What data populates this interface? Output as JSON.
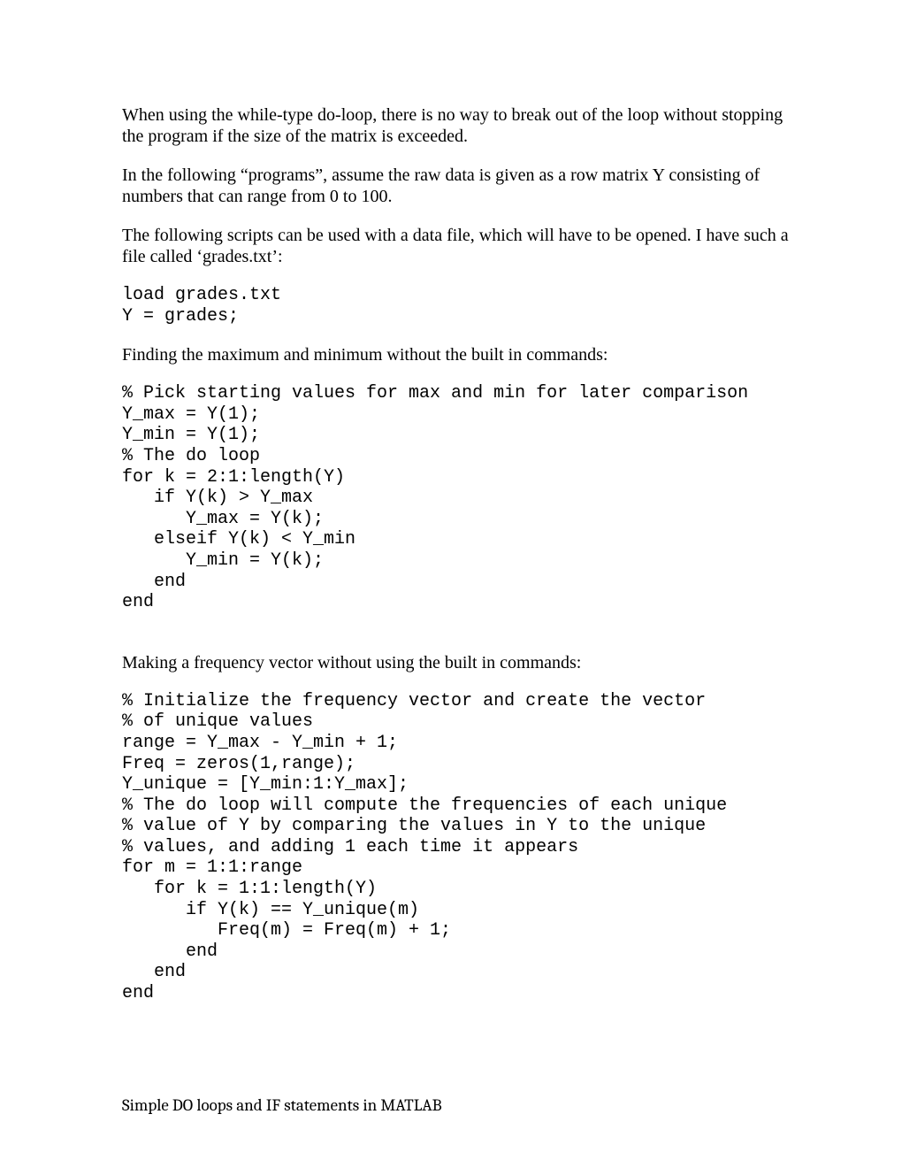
{
  "p1": "When using the while-type do-loop, there is no way to break out of the loop without stopping the program if the size of the matrix is exceeded.",
  "p2": "In the following “programs”, assume the raw data is given as a row matrix Y consisting of numbers that can range from 0 to 100.",
  "p3": "The following scripts can be used with a data file, which will have to be opened. I have such a file called ‘grades.txt’:",
  "code1": "load grades.txt\nY = grades;",
  "p4": "Finding the maximum and minimum without the built in commands:",
  "code2": "% Pick starting values for max and min for later comparison\nY_max = Y(1);\nY_min = Y(1);\n% The do loop\nfor k = 2:1:length(Y)\n   if Y(k) > Y_max\n      Y_max = Y(k);\n   elseif Y(k) < Y_min\n      Y_min = Y(k);\n   end\nend",
  "p5": "Making a frequency vector without using the built in commands:",
  "code3": "% Initialize the frequency vector and create the vector\n% of unique values\nrange = Y_max - Y_min + 1;\nFreq = zeros(1,range);\nY_unique = [Y_min:1:Y_max];\n% The do loop will compute the frequencies of each unique\n% value of Y by comparing the values in Y to the unique\n% values, and adding 1 each time it appears\nfor m = 1:1:range\n   for k = 1:1:length(Y)\n      if Y(k) == Y_unique(m)\n         Freq(m) = Freq(m) + 1;\n      end\n   end\nend",
  "footer": "Simple DO loops and IF statements in MATLAB"
}
